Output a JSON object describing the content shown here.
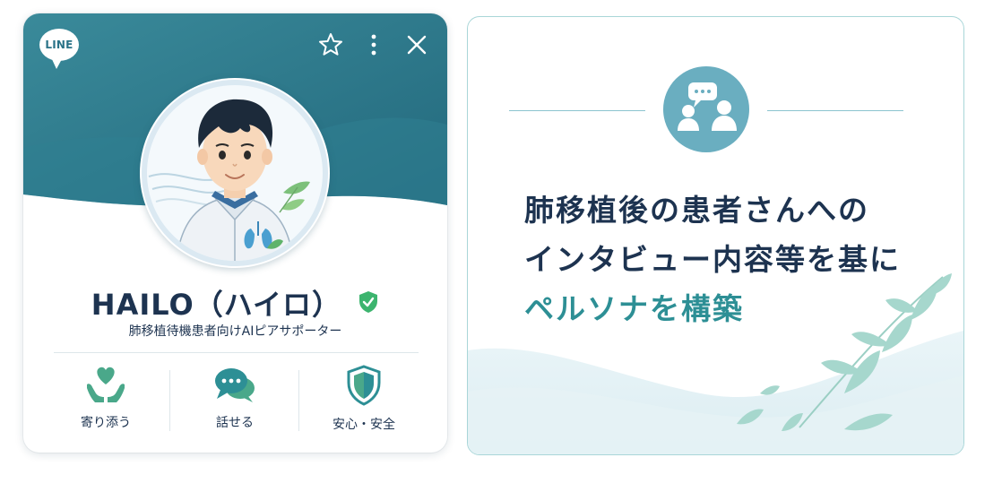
{
  "profile_card": {
    "logo_text": "LINE",
    "name": "HAILO（ハイロ）",
    "subtitle": "肺移植待機患者向けAIピアサポーター",
    "actions": [
      {
        "label": "寄り添う",
        "icon": "hands-heart-icon"
      },
      {
        "label": "話せる",
        "icon": "chat-bubbles-icon"
      },
      {
        "label": "安心・安全",
        "icon": "shield-icon"
      }
    ],
    "top_icons": [
      "star-icon",
      "more-vertical-icon",
      "close-icon"
    ]
  },
  "info_panel": {
    "icon": "people-chat-icon",
    "headline_line1": "肺移植後の患者さんへの",
    "headline_line2": "インタビュー内容等を基に",
    "headline_line3": "ペルソナを構築"
  },
  "colors": {
    "teal_dark": "#2a7a8c",
    "teal_accent": "#2d8f95",
    "navy_text": "#1d3350",
    "verified_green": "#3cb46e"
  }
}
